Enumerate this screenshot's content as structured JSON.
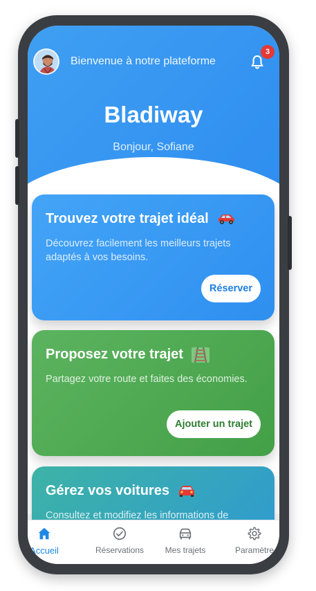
{
  "header": {
    "welcome_text": "Bienvenue à notre plateforme",
    "notification_count": "3",
    "brand": "Bladiway",
    "greeting": "Bonjour, Sofiane"
  },
  "cards": [
    {
      "title": "Trouvez votre trajet idéal",
      "emoji": "car-emoji",
      "description": "Découvrez facilement les meilleurs trajets adaptés à vos besoins.",
      "button": "Réserver",
      "color": "#3a9af4"
    },
    {
      "title": "Proposez votre trajet",
      "emoji": "railway-track-emoji",
      "description": "Partagez votre route et faites des économies.",
      "button": "Ajouter un trajet",
      "color": "#4caf50"
    },
    {
      "title": "Gérez vos voitures",
      "emoji": "car-front-emoji",
      "description": "Consultez et modifiez les informations de",
      "color": "#36a8b8"
    }
  ],
  "bottom_nav": [
    {
      "label": "Accueil",
      "icon": "home-icon",
      "active": true
    },
    {
      "label": "Réservations",
      "icon": "check-circle-icon",
      "active": false
    },
    {
      "label": "Mes trajets",
      "icon": "car-icon",
      "active": false
    },
    {
      "label": "Paramètre",
      "icon": "gear-icon",
      "active": false
    }
  ],
  "colors": {
    "primary": "#2f8ef0",
    "accent_active": "#1e88e5",
    "badge": "#e53935",
    "frame": "#3a3d42"
  }
}
